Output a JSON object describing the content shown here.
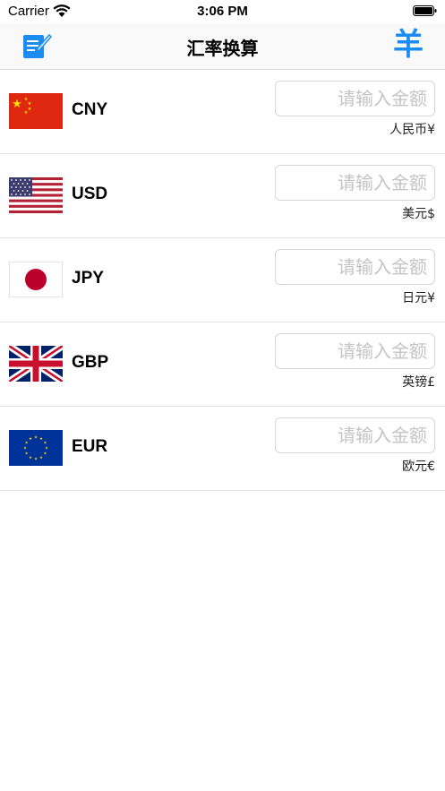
{
  "status_bar": {
    "carrier": "Carrier",
    "time": "3:06 PM"
  },
  "nav": {
    "title": "汇率换算",
    "right_symbol": "羊"
  },
  "colors": {
    "accent": "#1a8cf2"
  },
  "currencies": [
    {
      "code": "CNY",
      "name": "人民币¥",
      "placeholder": "请输入金额",
      "value": ""
    },
    {
      "code": "USD",
      "name": "美元$",
      "placeholder": "请输入金额",
      "value": ""
    },
    {
      "code": "JPY",
      "name": "日元¥",
      "placeholder": "请输入金额",
      "value": ""
    },
    {
      "code": "GBP",
      "name": "英镑£",
      "placeholder": "请输入金额",
      "value": ""
    },
    {
      "code": "EUR",
      "name": "欧元€",
      "placeholder": "请输入金额",
      "value": ""
    }
  ]
}
